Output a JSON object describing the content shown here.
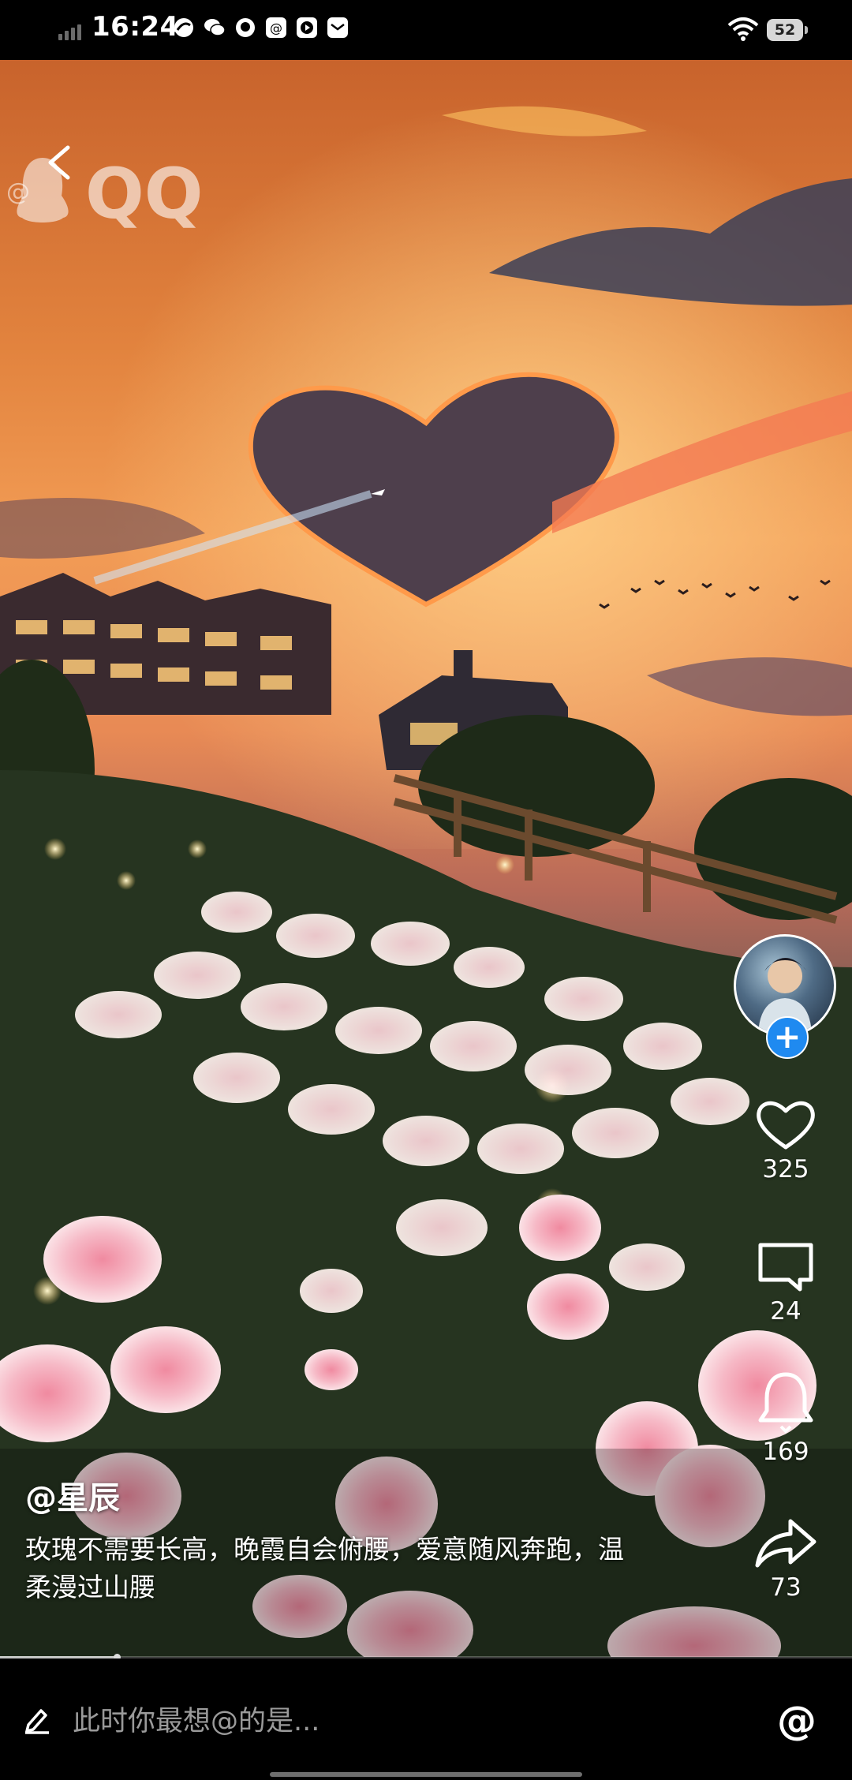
{
  "status_bar": {
    "time": "16:24",
    "battery": "52",
    "icons": [
      "signal-icon",
      "qq-browser-icon",
      "wechat-icon",
      "qq-icon",
      "weibo-icon",
      "video-icon",
      "mail-icon",
      "wifi-icon",
      "battery-icon"
    ]
  },
  "watermark": {
    "logo_text": "QQ",
    "handle": "@"
  },
  "author": {
    "name": "@星辰"
  },
  "caption": "玫瑰不需要长高，晚霞自会俯腰，爱意随风奔跑，温柔漫过山腰",
  "actions": {
    "follow_label": "+",
    "like_count": "325",
    "comment_count": "24",
    "remind_count": "169",
    "share_count": "73"
  },
  "progress": {
    "fraction": 0.137
  },
  "comment_bar": {
    "placeholder": "此时你最想@的是...",
    "mention_label": "@"
  },
  "colors": {
    "follow_blue": "#1f8af0",
    "placeholder_gray": "#9a9a9a"
  }
}
